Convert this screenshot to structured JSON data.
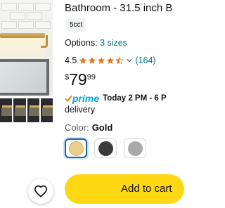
{
  "product": {
    "title": "Bathroom - 31.5 inch B",
    "size_chip": "5cct",
    "options_label": "Options: ",
    "options_link": "3 sizes",
    "rating": "4.5",
    "rating_value": 4.5,
    "review_count": "(164)",
    "price_currency": "$",
    "price_whole": "79",
    "price_fraction": "99"
  },
  "shipping": {
    "prime_word": "prime",
    "delivery_time": "Today 2 PM - 6 P",
    "delivery_word": "delivery"
  },
  "color": {
    "label": "Color:",
    "selected": "Gold",
    "swatches": [
      {
        "name": "gold-swatch",
        "color": "#e9cf8a",
        "selected": true
      },
      {
        "name": "black-swatch",
        "color": "#3a3a3a",
        "selected": false
      },
      {
        "name": "gray-swatch",
        "color": "#a9a9a9",
        "selected": false
      }
    ]
  },
  "actions": {
    "add_to_cart": "Add to cart",
    "wishlist_icon": "heart-icon"
  },
  "colors": {
    "link": "#007185",
    "star": "#de7921",
    "prime_blue": "#00a8e1",
    "cart_yellow": "#ffd814"
  }
}
